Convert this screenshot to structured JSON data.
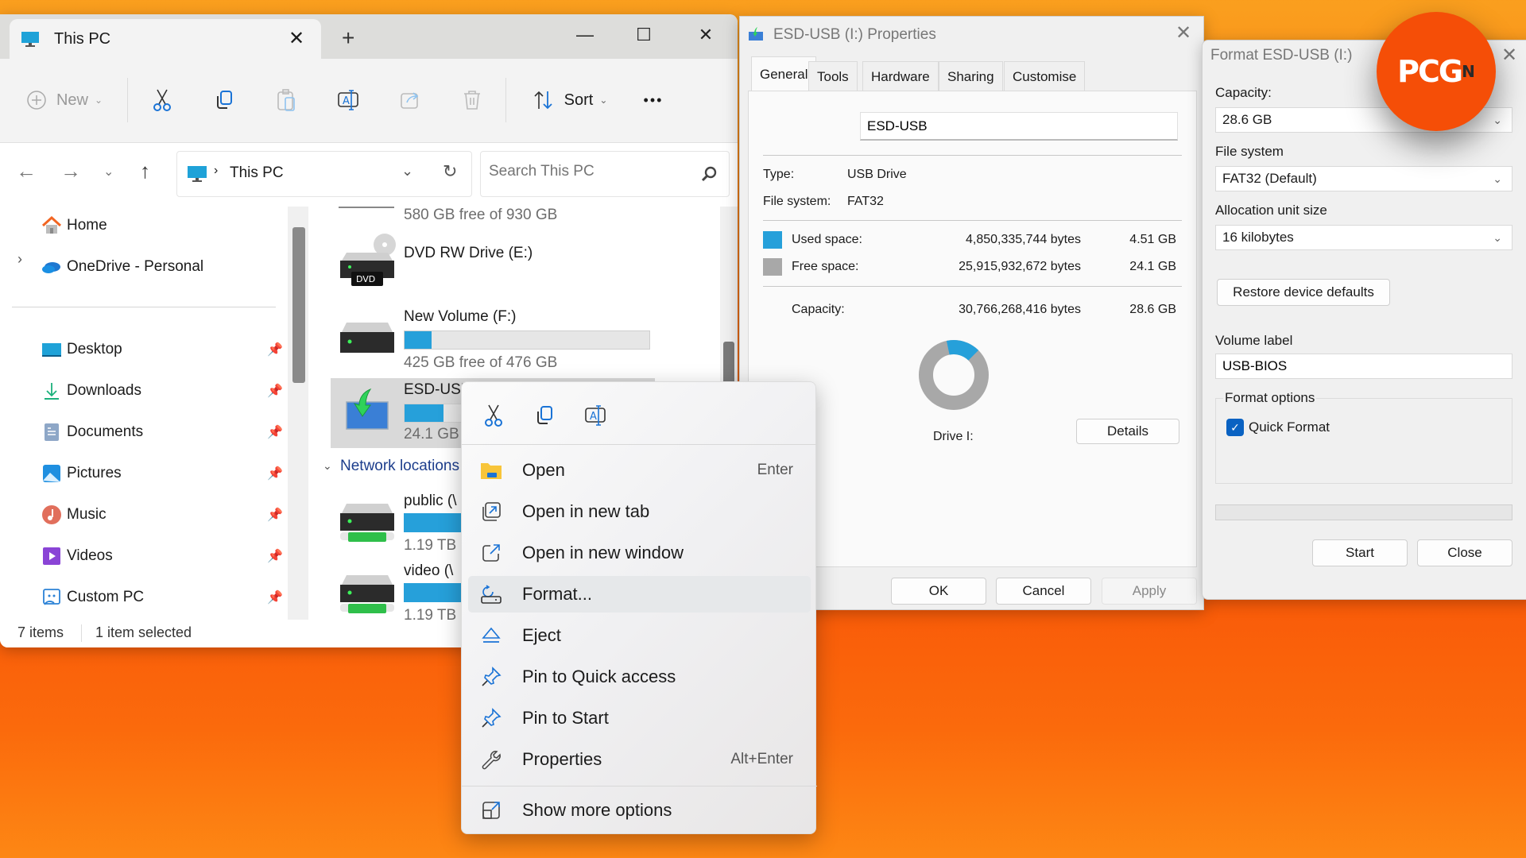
{
  "explorer": {
    "tab_title": "This PC",
    "toolbar": {
      "new_label": "New",
      "sort_label": "Sort",
      "more_label": "•••"
    },
    "address": {
      "location": "This PC"
    },
    "search": {
      "placeholder": "Search This PC"
    },
    "sidebar": {
      "home": "Home",
      "onedrive": "OneDrive - Personal",
      "items": [
        {
          "label": "Desktop",
          "icon": "desktop-icon"
        },
        {
          "label": "Downloads",
          "icon": "downloads-icon"
        },
        {
          "label": "Documents",
          "icon": "documents-icon"
        },
        {
          "label": "Pictures",
          "icon": "pictures-icon"
        },
        {
          "label": "Music",
          "icon": "music-icon"
        },
        {
          "label": "Videos",
          "icon": "videos-icon"
        },
        {
          "label": "Custom PC",
          "icon": "custom-folder-icon"
        }
      ]
    },
    "drives": [
      {
        "name": "",
        "free_text": "580 GB free of 930 GB"
      },
      {
        "name": "DVD RW Drive (E:)",
        "free_text": "",
        "badge": "DVD"
      },
      {
        "name": "New Volume (F:)",
        "free_text": "425 GB free of 476 GB",
        "used_fraction": 0.11
      },
      {
        "name": "ESD-USB (I:)",
        "free_text": "24.1 GB",
        "used_fraction": 0.16
      }
    ],
    "network_header": "Network locations",
    "network": [
      {
        "name": "public (\\",
        "size": "1.19 TB"
      },
      {
        "name": "video (\\",
        "size": "1.19 TB"
      }
    ],
    "status": {
      "items": "7 items",
      "selected": "1 item selected"
    }
  },
  "context_menu": {
    "items": [
      {
        "label": "Open",
        "shortcut": "Enter",
        "icon": "folder-icon"
      },
      {
        "label": "Open in new tab",
        "shortcut": "",
        "icon": "open-new-tab-icon"
      },
      {
        "label": "Open in new window",
        "shortcut": "",
        "icon": "open-new-window-icon"
      },
      {
        "label": "Format...",
        "shortcut": "",
        "icon": "format-icon"
      },
      {
        "label": "Eject",
        "shortcut": "",
        "icon": "eject-icon"
      },
      {
        "label": "Pin to Quick access",
        "shortcut": "",
        "icon": "pin-icon"
      },
      {
        "label": "Pin to Start",
        "shortcut": "",
        "icon": "pin-icon"
      },
      {
        "label": "Properties",
        "shortcut": "Alt+Enter",
        "icon": "wrench-icon"
      }
    ],
    "more": "Show more options"
  },
  "properties": {
    "title": "ESD-USB (I:) Properties",
    "tabs": [
      "General",
      "Tools",
      "Hardware",
      "Sharing",
      "Customise"
    ],
    "active_tab": "General",
    "label_value": "ESD-USB",
    "type_label": "Type:",
    "type_value": "USB Drive",
    "fs_label": "File system:",
    "fs_value": "FAT32",
    "used_label": "Used space:",
    "used_bytes": "4,850,335,744 bytes",
    "used_gb": "4.51 GB",
    "free_label": "Free space:",
    "free_bytes": "25,915,932,672 bytes",
    "free_gb": "24.1 GB",
    "cap_label": "Capacity:",
    "cap_bytes": "30,766,268,416 bytes",
    "cap_gb": "28.6 GB",
    "used_fraction": 0.158,
    "drive_label": "Drive I:",
    "details": "Details",
    "ok": "OK",
    "cancel": "Cancel",
    "apply": "Apply",
    "colors": {
      "used": "#26a0da",
      "free": "#a8a8a8"
    }
  },
  "format": {
    "title": "Format ESD-USB (I:)",
    "capacity_label": "Capacity:",
    "capacity_value": "28.6 GB",
    "fs_label": "File system",
    "fs_value": "FAT32 (Default)",
    "alloc_label": "Allocation unit size",
    "alloc_value": "16 kilobytes",
    "restore": "Restore device defaults",
    "volume_label": "Volume label",
    "volume_value": "USB-BIOS",
    "options_label": "Format options",
    "quick_format": "Quick Format",
    "quick_checked": true,
    "progress": 0,
    "start": "Start",
    "close": "Close"
  },
  "watermark": {
    "text": "PCG",
    "sup": "N"
  }
}
